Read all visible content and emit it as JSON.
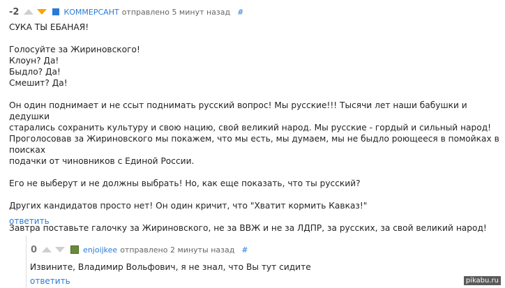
{
  "colors": {
    "link": "#2a7bd6",
    "vote_down_active": "#f5a600",
    "vote_inactive": "#cfcfcf",
    "user_badge": "#2a7bd6"
  },
  "comment": {
    "score": "-2",
    "author": "КОММЕРСАНТ",
    "time": "отправлено 5 минут назад",
    "anchor": "#",
    "paragraphs": [
      [
        "СУКА ТЫ ЕБАНАЯ!"
      ],
      [
        "Голосуйте за Жириновского!",
        "Клоун? Да!",
        "Быдло? Да!",
        "Смешит? Да!"
      ],
      [
        "Он один поднимает и не ссыт поднимать русский вопрос! Мы русские!!! Тысячи лет наши бабушки и дедушки",
        "старались сохранить культуру и свою нацию, свой великий народ. Мы русские - гордый и сильный народ!",
        "Проголосовав за Жириновского мы покажем, что мы есть, мы думаем, мы не быдло роющееся в помойках в поисках",
        "подачки от чиновников с Единой России."
      ],
      [
        "Его не выберут и не должны выбрать! Но, как еще показать, что ты русский?"
      ],
      [
        "Других кандидатов просто нет! Он один кричит, что \"Хватит кормить Кавказ!\""
      ],
      [
        "Завтра поставьте галочку за Жириновского, не за ВВЖ и не за ЛДПР, за русских, за свой великий народ!"
      ]
    ],
    "reply_label": "ответить"
  },
  "subcomment": {
    "score": "0",
    "author": "enjoijkee",
    "time": "отправлено 2 минуты назад",
    "anchor": "#",
    "text": "Извините, Владимир Вольфович, я не знал, что Вы тут сидите",
    "reply_label": "ответить"
  },
  "watermark": "pikabu.ru"
}
